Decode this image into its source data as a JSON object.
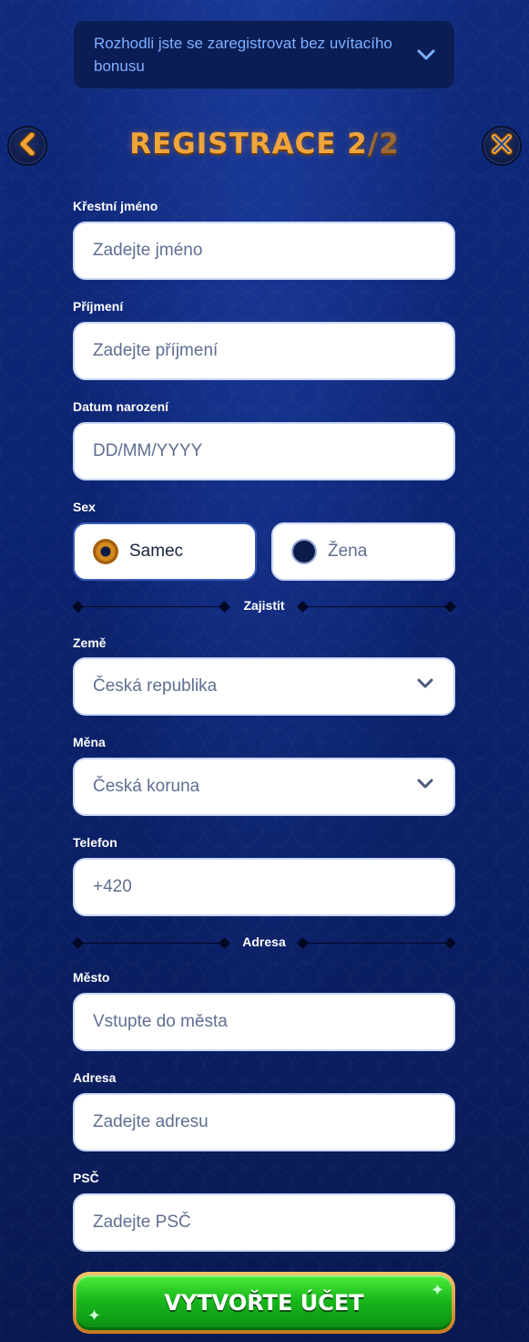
{
  "bonus_banner": {
    "text": "Rozhodli jste se zaregistrovat bez uvítacího bonusu",
    "icon": "chevron-down-icon"
  },
  "header": {
    "back_icon": "chevron-left-icon",
    "close_icon": "close-icon",
    "title_main": "REGISTRACE 2",
    "title_slash": "/2"
  },
  "form": {
    "first_name": {
      "label": "Křestní jméno",
      "placeholder": "Zadejte jméno",
      "value": ""
    },
    "last_name": {
      "label": "Příjmení",
      "placeholder": "Zadejte příjmení",
      "value": ""
    },
    "birth_date": {
      "label": "Datum narození",
      "placeholder": "DD/MM/YYYY",
      "value": ""
    },
    "sex": {
      "label": "Sex",
      "options": [
        {
          "label": "Samec",
          "selected": true
        },
        {
          "label": "Žena",
          "selected": false
        }
      ]
    },
    "section_secure": "Zajistit",
    "country": {
      "label": "Země",
      "value": "Česká republika"
    },
    "currency": {
      "label": "Měna",
      "value": "Česká koruna"
    },
    "phone": {
      "label": "Telefon",
      "value": "+420"
    },
    "section_address": "Adresa",
    "city": {
      "label": "Město",
      "placeholder": "Vstupte do města",
      "value": ""
    },
    "address": {
      "label": "Adresa",
      "placeholder": "Zadejte adresu",
      "value": ""
    },
    "zip": {
      "label": "PSČ",
      "placeholder": "Zadejte PSČ",
      "value": ""
    }
  },
  "submit": {
    "label": "VYTVOŘTE ÚČET"
  },
  "colors": {
    "accent_orange": "#f0a53a",
    "cta_green": "#18b81c",
    "background": "#0c2370"
  }
}
